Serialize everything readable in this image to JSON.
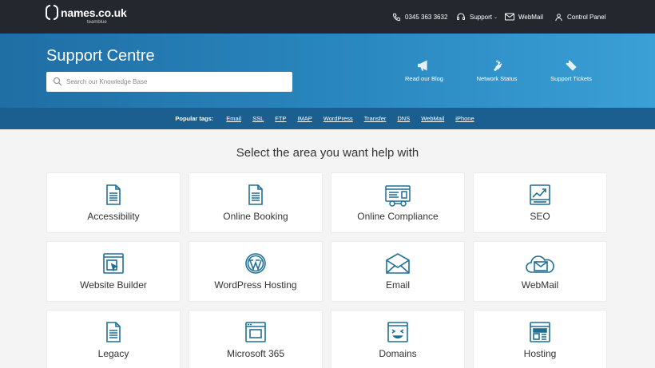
{
  "brand": {
    "name": "names.co.uk",
    "sub": "teamblue"
  },
  "topnav": {
    "phone": "0345 363 3632",
    "support": "Support",
    "webmail": "WebMail",
    "control_panel": "Control Panel"
  },
  "hero": {
    "title": "Support Centre",
    "search_placeholder": "Search our Knowledge Base",
    "links": [
      "Read our Blog",
      "Network Status",
      "Support Tickets"
    ]
  },
  "tags": {
    "label": "Popular tags:",
    "items": [
      "Email",
      "SSL",
      "FTP",
      "IMAP",
      "WordPress",
      "Transfer",
      "DNS",
      "WebMail",
      "iPhone"
    ]
  },
  "main": {
    "title": "Select the area you want help with",
    "cards": [
      {
        "label": "Accessibility",
        "icon": "document-icon"
      },
      {
        "label": "Online Booking",
        "icon": "document-icon"
      },
      {
        "label": "Online Compliance",
        "icon": "compliance-icon"
      },
      {
        "label": "SEO",
        "icon": "seo-chart-icon"
      },
      {
        "label": "Website Builder",
        "icon": "website-builder-icon"
      },
      {
        "label": "WordPress Hosting",
        "icon": "wordpress-icon"
      },
      {
        "label": "Email",
        "icon": "envelope-icon"
      },
      {
        "label": "WebMail",
        "icon": "webmail-cloud-icon"
      },
      {
        "label": "Legacy",
        "icon": "document-icon"
      },
      {
        "label": "Microsoft 365",
        "icon": "browser-window-icon"
      },
      {
        "label": "Domains",
        "icon": "domain-face-icon"
      },
      {
        "label": "Hosting",
        "icon": "hosting-layout-icon"
      }
    ]
  },
  "colors": {
    "accent": "#1f6f95",
    "topbar": "#24282e",
    "hero": "#2a88c0",
    "tagbar": "#1a5f8f"
  }
}
